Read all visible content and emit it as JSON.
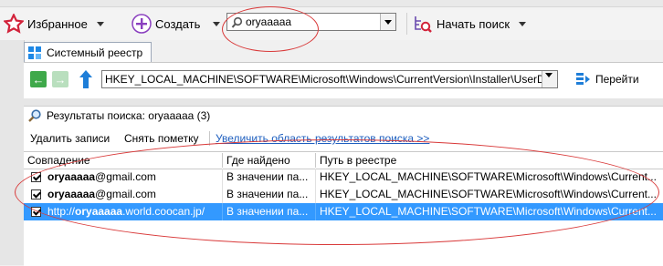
{
  "toolbar": {
    "favorites_label": "Избранное",
    "create_label": "Создать",
    "search_value": "oryaaaaa",
    "start_search_label": "Начать поиск"
  },
  "tabs": [
    {
      "label": "Системный реестр"
    }
  ],
  "address_bar": {
    "path": "HKEY_LOCAL_MACHINE\\SOFTWARE\\Microsoft\\Windows\\CurrentVersion\\Installer\\UserDat",
    "go_label": "Перейти"
  },
  "results": {
    "title": "Результаты поиска: oryaaaaa (3)",
    "actions": {
      "delete_label": "Удалить записи",
      "unmark_label": "Снять пометку",
      "expand_label": "Увеличить область результатов поиска >>"
    },
    "columns": [
      "Совпадение",
      "Где найдено",
      "Путь в реестре"
    ],
    "rows": [
      {
        "match_bold": "oryaaaaa",
        "match_rest": "@gmail.com",
        "match_prefix": "",
        "where": "В значении па...",
        "path": "HKEY_LOCAL_MACHINE\\SOFTWARE\\Microsoft\\Windows\\Current..."
      },
      {
        "match_bold": "oryaaaaa",
        "match_rest": "@gmail.com",
        "match_prefix": "",
        "where": "В значении па...",
        "path": "HKEY_LOCAL_MACHINE\\SOFTWARE\\Microsoft\\Windows\\Current..."
      },
      {
        "match_prefix": "http://",
        "match_bold": "oryaaaaa",
        "match_rest": ".world.coocan.jp/",
        "where": "В значении па...",
        "path": "HKEY_LOCAL_MACHINE\\SOFTWARE\\Microsoft\\Windows\\Current..."
      }
    ]
  },
  "colors": {
    "selection": "#3399ff",
    "annotation_red": "#d93a3a",
    "accent_purple": "#8a3fbf"
  }
}
